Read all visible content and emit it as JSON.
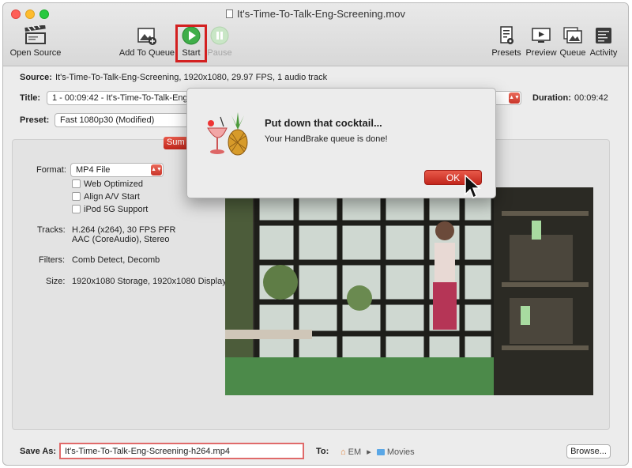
{
  "window": {
    "title": "It's-Time-To-Talk-Eng-Screening.mov"
  },
  "toolbar": {
    "open_source": "Open Source",
    "add_to_queue": "Add To Queue",
    "start": "Start",
    "pause": "Pause",
    "presets": "Presets",
    "preview": "Preview",
    "queue": "Queue",
    "activity": "Activity"
  },
  "source": {
    "label": "Source:",
    "value": "It's-Time-To-Talk-Eng-Screening, 1920x1080, 29.97 FPS, 1 audio track"
  },
  "title_row": {
    "label": "Title:",
    "value": "1 - 00:09:42 - It's-Time-To-Talk-Eng",
    "duration_label": "Duration:",
    "duration_value": "00:09:42"
  },
  "preset": {
    "label": "Preset:",
    "value": "Fast 1080p30 (Modified)"
  },
  "summary_tab": "Sum",
  "summary": {
    "format_label": "Format:",
    "format_value": "MP4 File",
    "checkboxes": [
      "Web Optimized",
      "Align A/V Start",
      "iPod 5G Support"
    ],
    "tracks_label": "Tracks:",
    "tracks_line1": "H.264 (x264), 30 FPS PFR",
    "tracks_line2": "AAC (CoreAudio), Stereo",
    "filters_label": "Filters:",
    "filters_value": "Comb Detect, Decomb",
    "size_label": "Size:",
    "size_value": "1920x1080 Storage, 1920x1080 Display"
  },
  "dialog": {
    "title": "Put down that cocktail...",
    "message": "Your HandBrake queue is done!",
    "ok_label": "OK"
  },
  "save": {
    "label": "Save As:",
    "value": "It's-Time-To-Talk-Eng-Screening-h264.mp4",
    "to_label": "To:",
    "path_home": "EM",
    "path_sep": "▸",
    "path_folder": "Movies",
    "browse_label": "Browse..."
  }
}
